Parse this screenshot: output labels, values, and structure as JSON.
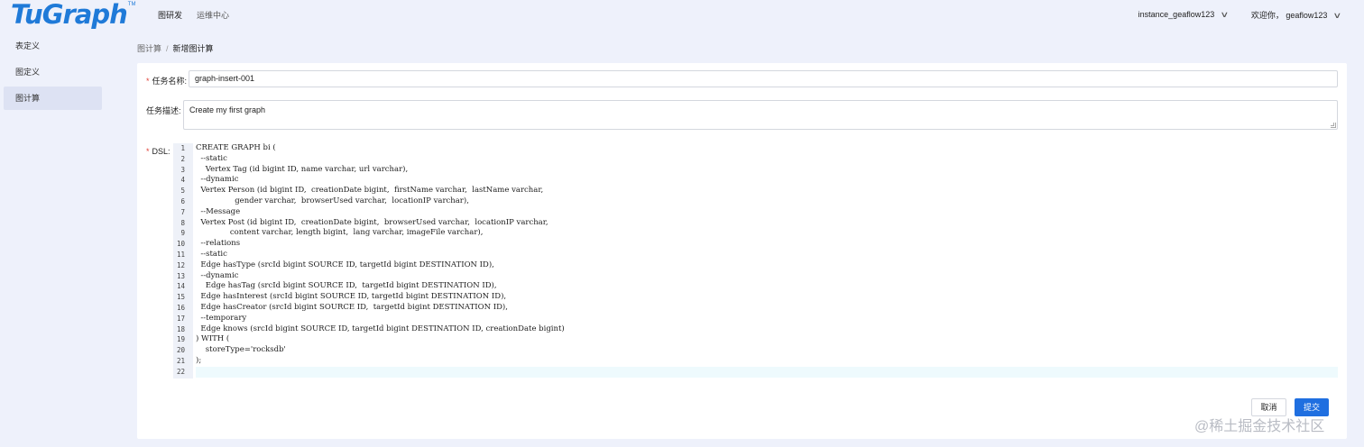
{
  "header": {
    "logo_text": "TuGraph",
    "logo_tm": "TM",
    "nav": [
      "图研发",
      "运维中心"
    ],
    "instance": "instance_geaflow123",
    "welcome": "欢迎你，",
    "user": "geaflow123"
  },
  "sidebar": {
    "items": [
      {
        "label": "表定义",
        "active": false
      },
      {
        "label": "图定义",
        "active": false
      },
      {
        "label": "图计算",
        "active": true
      }
    ]
  },
  "breadcrumb": {
    "parent": "图计算",
    "separator": "/",
    "current": "新增图计算"
  },
  "form": {
    "task_name_label": "任务名称:",
    "task_name_value": "graph-insert-001",
    "task_desc_label": "任务描述:",
    "task_desc_value": "Create my first graph",
    "dsl_label": "DSL:",
    "required_mark": "*"
  },
  "editor": {
    "line_numbers": [
      "1",
      "2",
      "3",
      "4",
      "5",
      "6",
      "7",
      "8",
      "9",
      "10",
      "11",
      "12",
      "13",
      "14",
      "15",
      "16",
      "17",
      "18",
      "19",
      "20",
      "21",
      "22"
    ],
    "lines": [
      "CREATE GRAPH bi (",
      "  --static",
      "    Vertex Tag (id bigint ID, name varchar, url varchar),",
      "  --dynamic",
      "  Vertex Person (id bigint ID,  creationDate bigint,  firstName varchar,  lastName varchar,",
      "                gender varchar,  browserUsed varchar,  locationIP varchar),",
      "  --Message",
      "  Vertex Post (id bigint ID,  creationDate bigint,  browserUsed varchar,  locationIP varchar,",
      "              content varchar, length bigint,  lang varchar, imageFile varchar),",
      "  --relations",
      "  --static",
      "  Edge hasType (srcId bigint SOURCE ID, targetId bigint DESTINATION ID),",
      "  --dynamic",
      "    Edge hasTag (srcId bigint SOURCE ID,  targetId bigint DESTINATION ID),",
      "  Edge hasInterest (srcId bigint SOURCE ID, targetId bigint DESTINATION ID),",
      "  Edge hasCreator (srcId bigint SOURCE ID,  targetId bigint DESTINATION ID),",
      "  --temporary",
      "  Edge knows (srcId bigint SOURCE ID, targetId bigint DESTINATION ID, creationDate bigint)",
      ") WITH (",
      "    storeType='rocksdb'",
      ");",
      ""
    ]
  },
  "actions": {
    "cancel": "取消",
    "submit": "提交"
  },
  "watermark": "@稀土掘金技术社区"
}
